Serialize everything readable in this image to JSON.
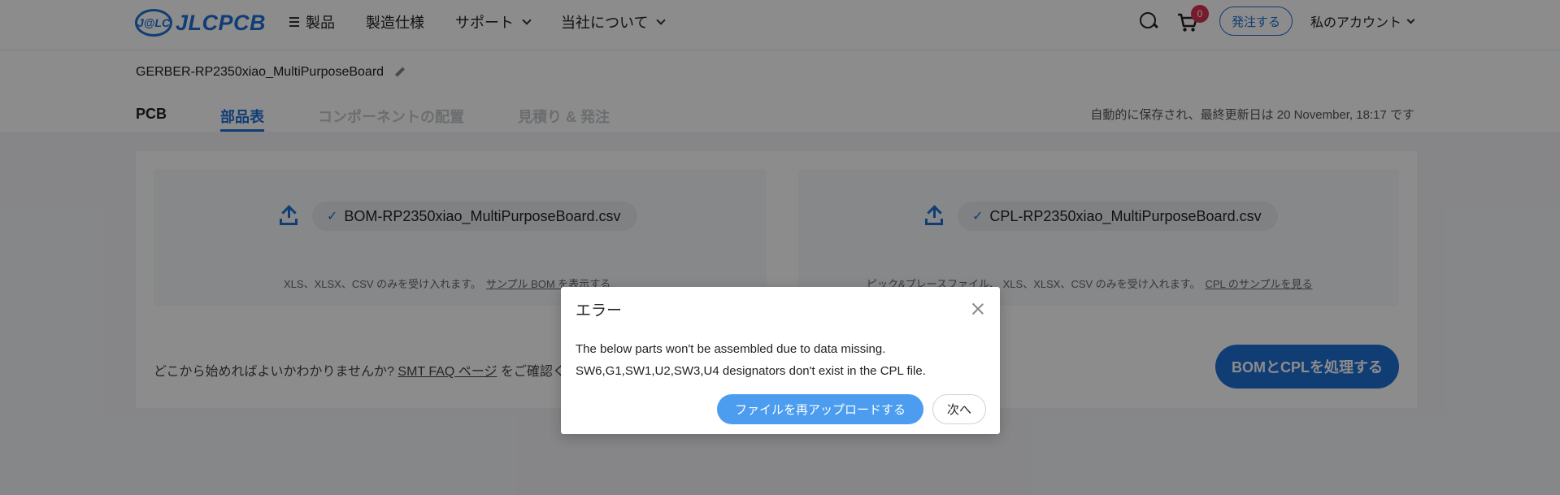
{
  "header": {
    "logo_mark": "J@LC",
    "logo_text": "JLCPCB",
    "nav": [
      {
        "label": "製品"
      },
      {
        "label": "製造仕様"
      },
      {
        "label": "サポート"
      },
      {
        "label": "当社について"
      }
    ],
    "cart_count": "0",
    "order_label": "発注する",
    "account_label": "私のアカウント"
  },
  "subheader": {
    "file_title": "GERBER-RP2350xiao_MultiPurposeBoard",
    "tabs": [
      {
        "label": "PCB",
        "state": "done"
      },
      {
        "label": "部品表",
        "state": "active"
      },
      {
        "label": "コンポーネントの配置",
        "state": "pending"
      },
      {
        "label": "見積り & 発注",
        "state": "pending"
      }
    ],
    "save_note": "自動的に保存され、最終更新日は 20 November, 18:17 です"
  },
  "bom": {
    "file_name": "BOM-RP2350xiao_MultiPurposeBoard.csv",
    "accept_text": "XLS、XLSX、CSV のみを受け入れます。",
    "sample_link": "サンプル BOM を表示する"
  },
  "cpl": {
    "file_name": "CPL-RP2350xiao_MultiPurposeBoard.csv",
    "accept_text": "ピック&プレースファイル、 XLS、XLSX、CSV のみを受け入れます。",
    "sample_link": "CPL のサンプルを見る"
  },
  "faq": {
    "prefix": "どこから始めればよいかわかりませんか? ",
    "link": "SMT FAQ ページ",
    "suffix": " をご確認く"
  },
  "process_button": "BOMとCPLを処理する",
  "dialog": {
    "title": "エラー",
    "message_line1": "The below parts won't be assembled due to data missing.",
    "message_line2": "SW6,G1,SW1,U2,SW3,U4 designators don't exist in the CPL file.",
    "reupload_label": "ファイルを再アップロードする",
    "next_label": "次へ"
  },
  "colors": {
    "brand": "#1f6fd6",
    "badge": "#d9304c",
    "dialog_primary": "#4c9df0"
  }
}
